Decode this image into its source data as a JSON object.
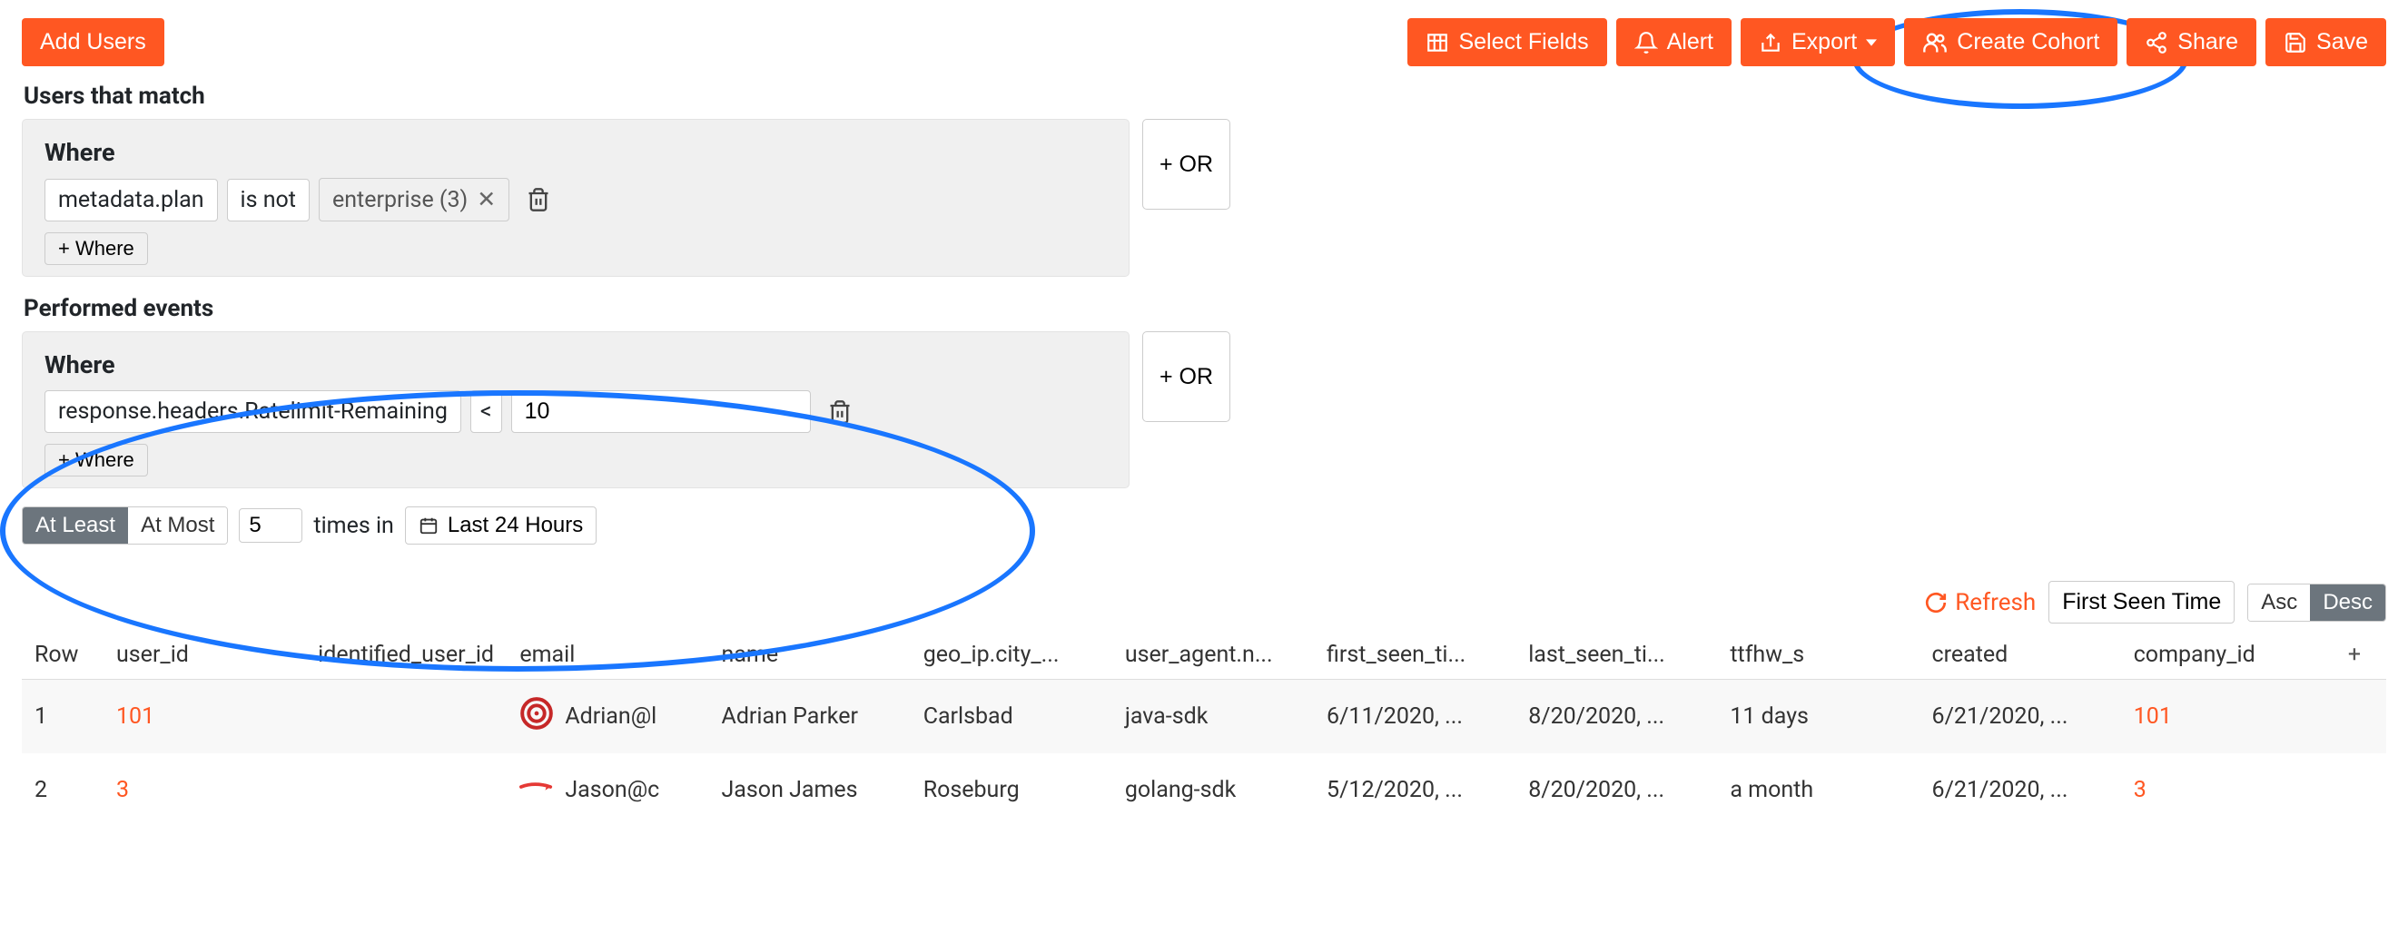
{
  "toolbar": {
    "add_users": "Add Users",
    "select_fields": "Select Fields",
    "alert": "Alert",
    "export": "Export",
    "create_cohort": "Create Cohort",
    "share": "Share",
    "save": "Save"
  },
  "sections": {
    "users_match_title": "Users that match",
    "events_title": "Performed events",
    "where_label": "Where",
    "plus_where": "+ Where",
    "or_button": "+ OR"
  },
  "filter1": {
    "field": "metadata.plan",
    "operator": "is not",
    "tag": "enterprise (3)"
  },
  "filter2": {
    "field": "response.headers.Ratelimit-Remaining",
    "operator": "<",
    "value": "10"
  },
  "timing": {
    "at_least": "At Least",
    "at_most": "At Most",
    "count": "5",
    "times_in": "times in",
    "range": "Last 24 Hours"
  },
  "results_top": {
    "refresh": "Refresh",
    "first_seen": "First Seen Time",
    "asc": "Asc",
    "desc": "Desc"
  },
  "columns": [
    "Row",
    "user_id",
    "identified_user_id",
    "email",
    "name",
    "geo_ip.city_...",
    "user_agent.n...",
    "first_seen_ti...",
    "last_seen_ti...",
    "ttfhw_s",
    "created",
    "company_id"
  ],
  "rows": [
    {
      "row": "1",
      "user_id": "101",
      "identified_user_id": "",
      "email": "Adrian@l",
      "name": "Adrian Parker",
      "city": "Carlsbad",
      "ua": "java-sdk",
      "first": "6/11/2020, ...",
      "last": "8/20/2020, ...",
      "ttfhw": "11 days",
      "created": "6/21/2020, ...",
      "company": "101",
      "icon": "target"
    },
    {
      "row": "2",
      "user_id": "3",
      "identified_user_id": "",
      "email": "Jason@c",
      "name": "Jason James",
      "city": "Roseburg",
      "ua": "golang-sdk",
      "first": "5/12/2020, ...",
      "last": "8/20/2020, ...",
      "ttfhw": "a month",
      "created": "6/21/2020, ...",
      "company": "3",
      "icon": "arrow"
    }
  ]
}
